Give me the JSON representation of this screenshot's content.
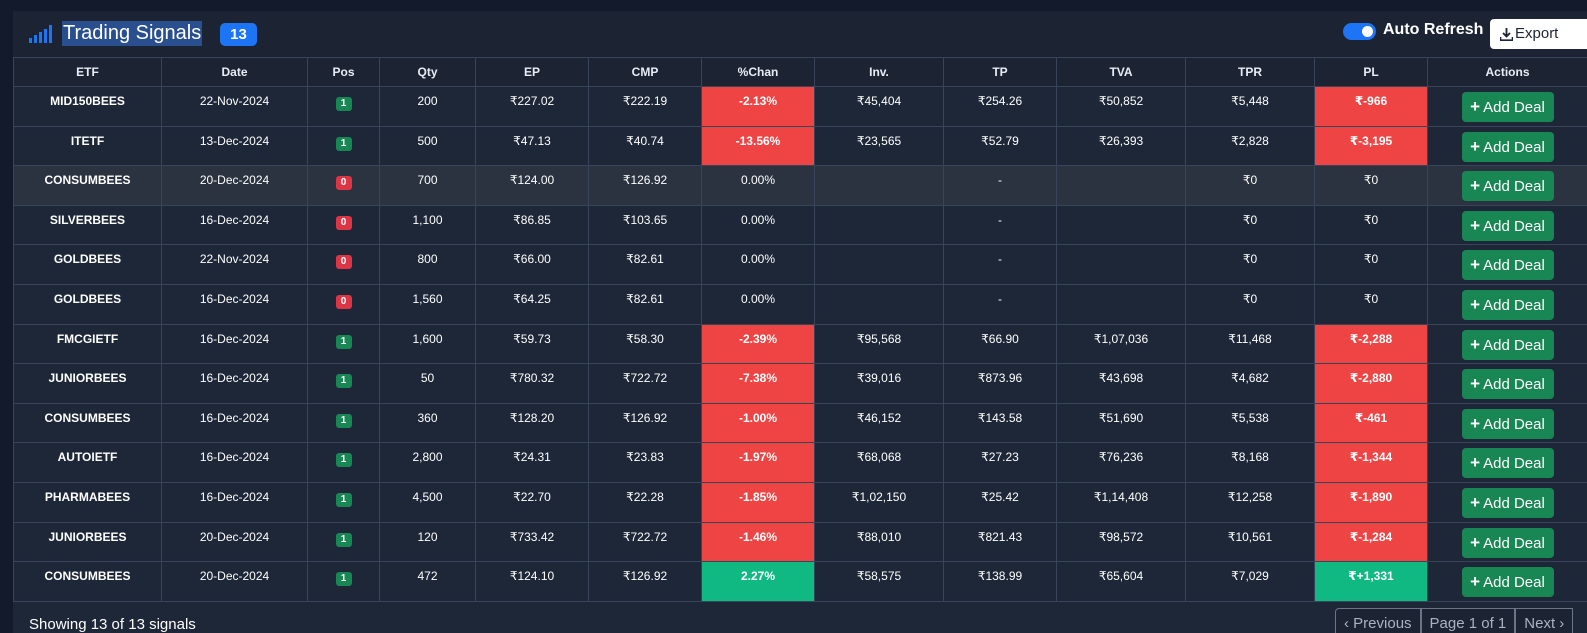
{
  "header": {
    "title": "Trading Signals",
    "count": "13",
    "auto_refresh_label": "Auto Refresh",
    "auto_refresh_on": true,
    "export_label": "Export"
  },
  "table": {
    "columns": [
      "ETF",
      "Date",
      "Pos",
      "Qty",
      "EP",
      "CMP",
      "%Chan",
      "Inv.",
      "TP",
      "TVA",
      "TPR",
      "PL",
      "Actions"
    ],
    "action_label": "Add Deal",
    "rows": [
      {
        "etf": "MID150BEES",
        "date": "22-Nov-2024",
        "pos": "1",
        "qty": "200",
        "ep": "₹227.02",
        "cmp": "₹222.19",
        "chg": "-2.13%",
        "inv": "₹45,404",
        "tp": "₹254.26",
        "tva": "₹50,852",
        "tpr": "₹5,448",
        "pl": "₹-966"
      },
      {
        "etf": "ITETF",
        "date": "13-Dec-2024",
        "pos": "1",
        "qty": "500",
        "ep": "₹47.13",
        "cmp": "₹40.74",
        "chg": "-13.56%",
        "inv": "₹23,565",
        "tp": "₹52.79",
        "tva": "₹26,393",
        "tpr": "₹2,828",
        "pl": "₹-3,195"
      },
      {
        "etf": "CONSUMBEES",
        "date": "20-Dec-2024",
        "pos": "0",
        "qty": "700",
        "ep": "₹124.00",
        "cmp": "₹126.92",
        "chg": "0.00%",
        "inv": "",
        "tp": "-",
        "tva": "",
        "tpr": "₹0",
        "pl": "₹0"
      },
      {
        "etf": "SILVERBEES",
        "date": "16-Dec-2024",
        "pos": "0",
        "qty": "1,100",
        "ep": "₹86.85",
        "cmp": "₹103.65",
        "chg": "0.00%",
        "inv": "",
        "tp": "-",
        "tva": "",
        "tpr": "₹0",
        "pl": "₹0"
      },
      {
        "etf": "GOLDBEES",
        "date": "22-Nov-2024",
        "pos": "0",
        "qty": "800",
        "ep": "₹66.00",
        "cmp": "₹82.61",
        "chg": "0.00%",
        "inv": "",
        "tp": "-",
        "tva": "",
        "tpr": "₹0",
        "pl": "₹0"
      },
      {
        "etf": "GOLDBEES",
        "date": "16-Dec-2024",
        "pos": "0",
        "qty": "1,560",
        "ep": "₹64.25",
        "cmp": "₹82.61",
        "chg": "0.00%",
        "inv": "",
        "tp": "-",
        "tva": "",
        "tpr": "₹0",
        "pl": "₹0"
      },
      {
        "etf": "FMCGIETF",
        "date": "16-Dec-2024",
        "pos": "1",
        "qty": "1,600",
        "ep": "₹59.73",
        "cmp": "₹58.30",
        "chg": "-2.39%",
        "inv": "₹95,568",
        "tp": "₹66.90",
        "tva": "₹1,07,036",
        "tpr": "₹11,468",
        "pl": "₹-2,288"
      },
      {
        "etf": "JUNIORBEES",
        "date": "16-Dec-2024",
        "pos": "1",
        "qty": "50",
        "ep": "₹780.32",
        "cmp": "₹722.72",
        "chg": "-7.38%",
        "inv": "₹39,016",
        "tp": "₹873.96",
        "tva": "₹43,698",
        "tpr": "₹4,682",
        "pl": "₹-2,880"
      },
      {
        "etf": "CONSUMBEES",
        "date": "16-Dec-2024",
        "pos": "1",
        "qty": "360",
        "ep": "₹128.20",
        "cmp": "₹126.92",
        "chg": "-1.00%",
        "inv": "₹46,152",
        "tp": "₹143.58",
        "tva": "₹51,690",
        "tpr": "₹5,538",
        "pl": "₹-461"
      },
      {
        "etf": "AUTOIETF",
        "date": "16-Dec-2024",
        "pos": "1",
        "qty": "2,800",
        "ep": "₹24.31",
        "cmp": "₹23.83",
        "chg": "-1.97%",
        "inv": "₹68,068",
        "tp": "₹27.23",
        "tva": "₹76,236",
        "tpr": "₹8,168",
        "pl": "₹-1,344"
      },
      {
        "etf": "PHARMABEES",
        "date": "16-Dec-2024",
        "pos": "1",
        "qty": "4,500",
        "ep": "₹22.70",
        "cmp": "₹22.28",
        "chg": "-1.85%",
        "inv": "₹1,02,150",
        "tp": "₹25.42",
        "tva": "₹1,14,408",
        "tpr": "₹12,258",
        "pl": "₹-1,890"
      },
      {
        "etf": "JUNIORBEES",
        "date": "20-Dec-2024",
        "pos": "1",
        "qty": "120",
        "ep": "₹733.42",
        "cmp": "₹722.72",
        "chg": "-1.46%",
        "inv": "₹88,010",
        "tp": "₹821.43",
        "tva": "₹98,572",
        "tpr": "₹10,561",
        "pl": "₹-1,284"
      },
      {
        "etf": "CONSUMBEES",
        "date": "20-Dec-2024",
        "pos": "1",
        "qty": "472",
        "ep": "₹124.10",
        "cmp": "₹126.92",
        "chg": "2.27%",
        "inv": "₹58,575",
        "tp": "₹138.99",
        "tva": "₹65,604",
        "tpr": "₹7,029",
        "pl": "₹+1,331"
      }
    ]
  },
  "footer": {
    "summary": "Showing 13 of 13 signals",
    "prev_label": "Previous",
    "page_label": "Page 1 of 1",
    "next_label": "Next"
  },
  "colors": {
    "negative": "#ef4444",
    "positive": "#10b981",
    "accent": "#1d74f5",
    "action_green": "#198754"
  }
}
